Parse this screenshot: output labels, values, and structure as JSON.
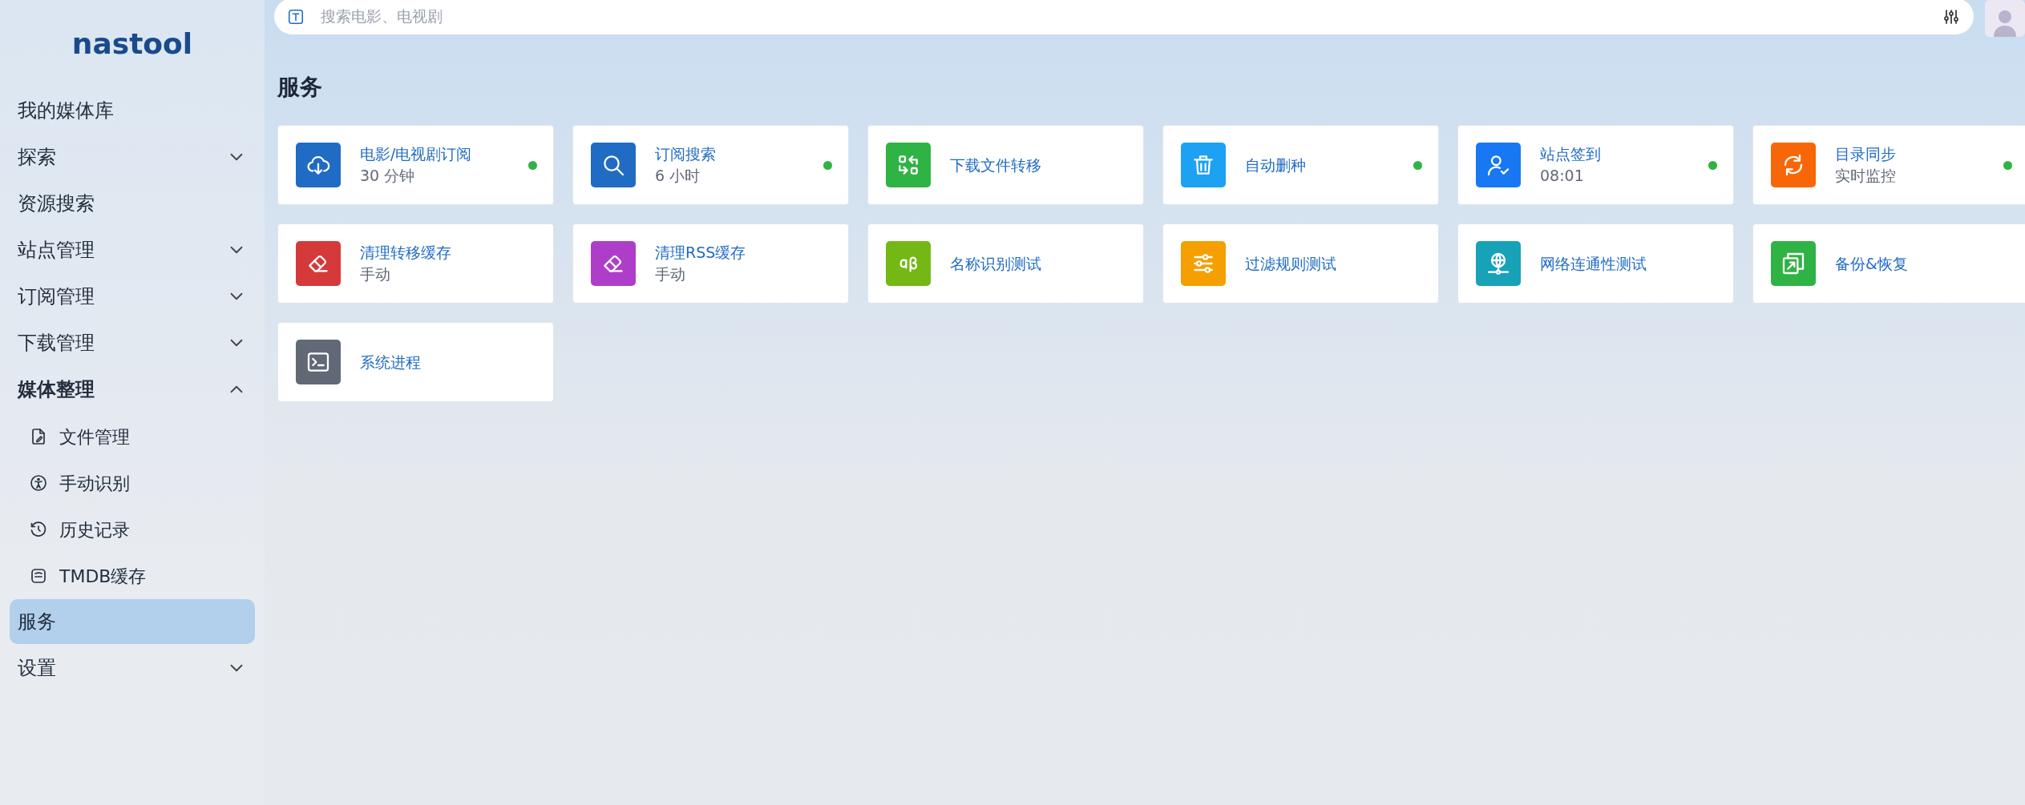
{
  "sidebar": {
    "logo": "nastool",
    "items": [
      {
        "label": "我的媒体库",
        "kind": "link",
        "selected": false
      },
      {
        "label": "探索",
        "kind": "group",
        "expanded": false,
        "selected": false
      },
      {
        "label": "资源搜索",
        "kind": "link",
        "selected": false
      },
      {
        "label": "站点管理",
        "kind": "group",
        "expanded": false,
        "selected": false
      },
      {
        "label": "订阅管理",
        "kind": "group",
        "expanded": false,
        "selected": false
      },
      {
        "label": "下载管理",
        "kind": "group",
        "expanded": false,
        "selected": false
      },
      {
        "label": "媒体整理",
        "kind": "group",
        "expanded": true,
        "selected": false,
        "children": [
          {
            "label": "文件管理",
            "selected": false
          },
          {
            "label": "手动识别",
            "selected": false
          },
          {
            "label": "历史记录",
            "selected": false
          },
          {
            "label": "TMDB缓存",
            "selected": false
          }
        ]
      },
      {
        "label": "服务",
        "kind": "link",
        "selected": true
      },
      {
        "label": "设置",
        "kind": "group",
        "expanded": false,
        "selected": false
      }
    ]
  },
  "search": {
    "placeholder": "搜索电影、电视剧"
  },
  "page_title": "服务",
  "services": [
    {
      "title": "电影/电视剧订阅",
      "subtitle": "30 分钟",
      "color": "#206bc4",
      "running": true
    },
    {
      "title": "订阅搜索",
      "subtitle": "6 小时",
      "color": "#206bc4",
      "running": true
    },
    {
      "title": "下载文件转移",
      "color": "#2fb344",
      "running": false
    },
    {
      "title": "自动删种",
      "color": "#1da1f2",
      "running": true
    },
    {
      "title": "站点签到",
      "subtitle": "08:01",
      "color": "#1877f2",
      "running": true
    },
    {
      "title": "目录同步",
      "subtitle": "实时监控",
      "color": "#f76707",
      "running": true
    },
    {
      "title": "清理转移缓存",
      "subtitle": "手动",
      "color": "#d63939",
      "running": false
    },
    {
      "title": "清理RSS缓存",
      "subtitle": "手动",
      "color": "#ae3ec9",
      "running": false
    },
    {
      "title": "名称识别测试",
      "color": "#74b816",
      "running": false
    },
    {
      "title": "过滤规则测试",
      "color": "#f59f00",
      "running": false
    },
    {
      "title": "网络连通性测试",
      "color": "#17a2b8",
      "running": false
    },
    {
      "title": "备份&恢复",
      "color": "#2fb344",
      "running": false
    },
    {
      "title": "系统进程",
      "color": "#616876",
      "running": false
    }
  ]
}
